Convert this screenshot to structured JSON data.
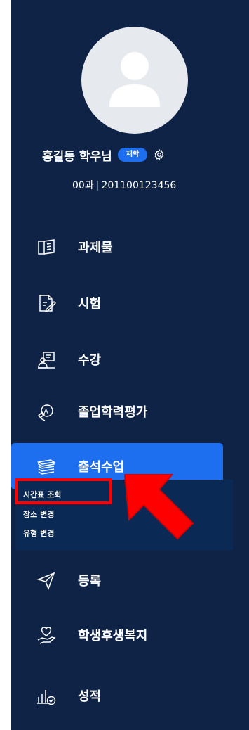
{
  "profile": {
    "name": "홍길동 학우님",
    "status_badge": "재학",
    "department": "00과",
    "student_id": "201100123456"
  },
  "menu": [
    {
      "label": "과제물",
      "icon": "book-icon"
    },
    {
      "label": "시험",
      "icon": "exam-icon"
    },
    {
      "label": "수강",
      "icon": "lecture-icon"
    },
    {
      "label": "졸업학력평가",
      "icon": "graduation-eval-icon"
    },
    {
      "label": "출석수업",
      "icon": "books-stack-icon",
      "active": true
    },
    {
      "label": "등록",
      "icon": "paper-plane-icon"
    },
    {
      "label": "학생후생복지",
      "icon": "heart-hand-icon"
    },
    {
      "label": "성적",
      "icon": "chart-check-icon"
    }
  ],
  "submenu": [
    {
      "label": "시간표 조회"
    },
    {
      "label": "장소 변경"
    },
    {
      "label": "유형 변경"
    }
  ],
  "colors": {
    "sidebar_bg": "#0f2347",
    "accent": "#1e6ff0",
    "annotation": "#ff0000"
  }
}
